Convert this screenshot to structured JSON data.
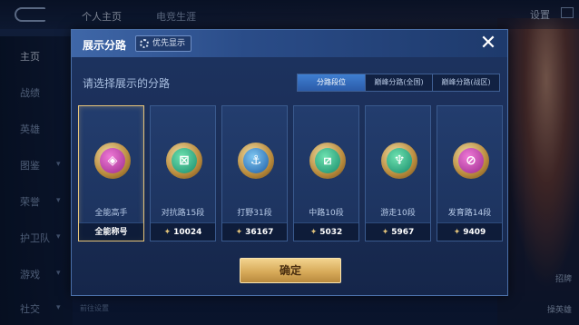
{
  "background": {
    "top_tabs": [
      "个人主页",
      "电竞生涯"
    ],
    "top_right_label": "设置",
    "side_nav": [
      "主页",
      "战绩",
      "英雄",
      "图鉴",
      "荣誉",
      "护卫队",
      "游戏",
      "社交"
    ],
    "right_labels": [
      "招牌",
      "操英雄"
    ],
    "bottom_hint": "前往设置"
  },
  "modal": {
    "title": "展示分路",
    "priority_label": "优先显示",
    "prompt": "请选择展示的分路",
    "segments": [
      {
        "label": "分路段位",
        "active": true
      },
      {
        "label": "巅峰分路(全国)",
        "active": false
      },
      {
        "label": "巅峰分路(战区)",
        "active": false
      }
    ],
    "cards": [
      {
        "label": "全能高手",
        "foot": "全能称号",
        "show_icon": false,
        "emblem": "pink",
        "glyph": "◈",
        "selected": true
      },
      {
        "label": "对抗路15段",
        "foot": "10024",
        "show_icon": true,
        "emblem": "green",
        "glyph": "⊠",
        "selected": false
      },
      {
        "label": "打野31段",
        "foot": "36167",
        "show_icon": true,
        "emblem": "blue",
        "glyph": "⚓",
        "selected": false
      },
      {
        "label": "中路10段",
        "foot": "5032",
        "show_icon": true,
        "emblem": "green",
        "glyph": "⧄",
        "selected": false
      },
      {
        "label": "游走10段",
        "foot": "5967",
        "show_icon": true,
        "emblem": "green",
        "glyph": "♆",
        "selected": false
      },
      {
        "label": "发育路14段",
        "foot": "9409",
        "show_icon": true,
        "emblem": "pink",
        "glyph": "⊘",
        "selected": false
      }
    ],
    "confirm_label": "确定",
    "close_glyph": "✕"
  },
  "colors": {
    "accent_blue": "#3f7fd2",
    "gold": "#d8ab5a",
    "selected_border": "#e6c47a"
  }
}
